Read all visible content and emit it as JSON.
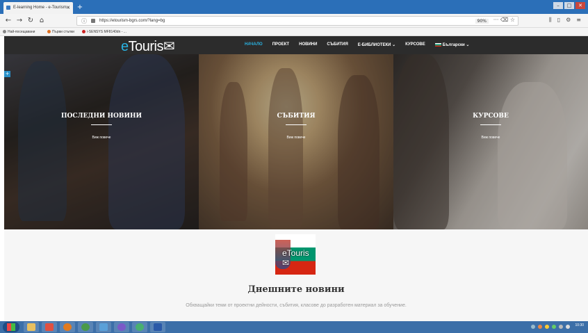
{
  "browser": {
    "tab_title": "E-learning Home - e-Tourism...",
    "tab_close": "✕",
    "new_tab": "+",
    "url": "https://etourism-bgrs.com/?lang=bg",
    "zoom": "90%",
    "page_actions": "··· ⌫ ☆",
    "tool_icons": [
      "library-icon",
      "sidebar-icon",
      "extensions-icon",
      "menu-icon"
    ],
    "bookmarks": [
      {
        "label": "Най-посещавани",
        "color": "#888888"
      },
      {
        "label": "Първи стъпки",
        "color": "#e07020"
      },
      {
        "label": "i-SENSYS MF8140dn - ...",
        "color": "#cc2222"
      }
    ]
  },
  "site": {
    "logo_e": "e",
    "logo_rest": "Touris",
    "logo_mark": "✉",
    "nav": [
      {
        "label": "НАЧАЛО",
        "active": true
      },
      {
        "label": "ПРОЕКТ",
        "active": false
      },
      {
        "label": "НОВИНИ",
        "active": false
      },
      {
        "label": "СЪБИТИЯ",
        "active": false
      },
      {
        "label": "Е-БИБЛИОТЕКИ ⌄",
        "active": false
      },
      {
        "label": "КУРСОВЕ",
        "active": false
      },
      {
        "label": "Български ⌄",
        "active": false
      }
    ],
    "expand_button": "+"
  },
  "hero": {
    "panels": [
      {
        "title": "ПОСЛЕДНИ НОВИНИ",
        "more": "Виж повече"
      },
      {
        "title": "СЪБИТИЯ",
        "more": "Виж повече"
      },
      {
        "title": "КУРСОВЕ",
        "more": "Виж повече"
      }
    ]
  },
  "content": {
    "badge_logo": "eTouris✉",
    "title": "Днешните новини",
    "subtitle": "Обхващайки теми от проектни дейности, събития, класове до разработен материал за обучение."
  },
  "taskbar": {
    "clock_time": "10:30",
    "clock_date": ""
  },
  "colors": {
    "accent": "#2ab4e4",
    "header_bg": "#2c2c2c",
    "browser_tabbar": "#2b6fb8",
    "taskbar": "#3c6fa8"
  }
}
